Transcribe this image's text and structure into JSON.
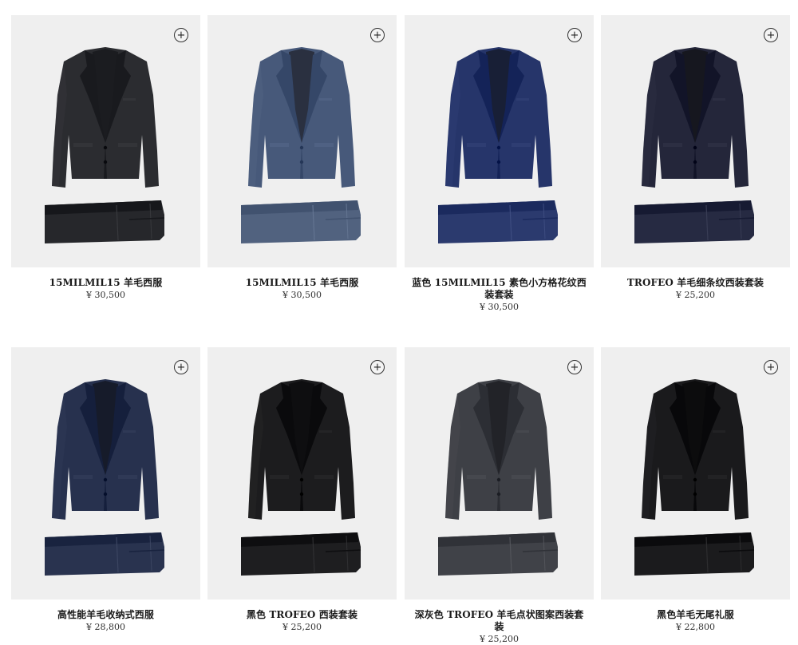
{
  "add_label": "+",
  "products": [
    {
      "name": "15MILMIL15 羊毛西服",
      "price": "¥ 30,500",
      "jacket": "#2b2c30",
      "trousers": "#26272b",
      "shirt": "#1b1c20"
    },
    {
      "name": "15MILMIL15 羊毛西服",
      "price": "¥ 30,500",
      "jacket": "#47597a",
      "trousers": "#51627f",
      "shirt": "#2a3040"
    },
    {
      "name": "蓝色 15MILMIL15 素色小方格花纹西装套装",
      "price": "¥ 30,500",
      "jacket": "#26356a",
      "trousers": "#2b3a6e",
      "shirt": "#181f36"
    },
    {
      "name": "TROFEO 羊毛细条纹西装套装",
      "price": "¥ 25,200",
      "jacket": "#24263a",
      "trousers": "#262a42",
      "shirt": "#16171f"
    },
    {
      "name": "高性能羊毛收纳式西服",
      "price": "¥ 28,800",
      "jacket": "#27314e",
      "trousers": "#29334f",
      "shirt": "#161b2a"
    },
    {
      "name": "黑色 TROFEO 西装套装",
      "price": "¥ 25,200",
      "jacket": "#1c1c1e",
      "trousers": "#1e1e20",
      "shirt": "#0e0e10"
    },
    {
      "name": "深灰色 TROFEO 羊毛点状图案西装套装",
      "price": "¥ 25,200",
      "jacket": "#3e4046",
      "trousers": "#404248",
      "shirt": "#222328"
    },
    {
      "name": "黑色羊毛无尾礼服",
      "price": "¥ 22,800",
      "jacket": "#1a1a1c",
      "trousers": "#1b1b1d",
      "shirt": "#0c0c0d"
    }
  ]
}
